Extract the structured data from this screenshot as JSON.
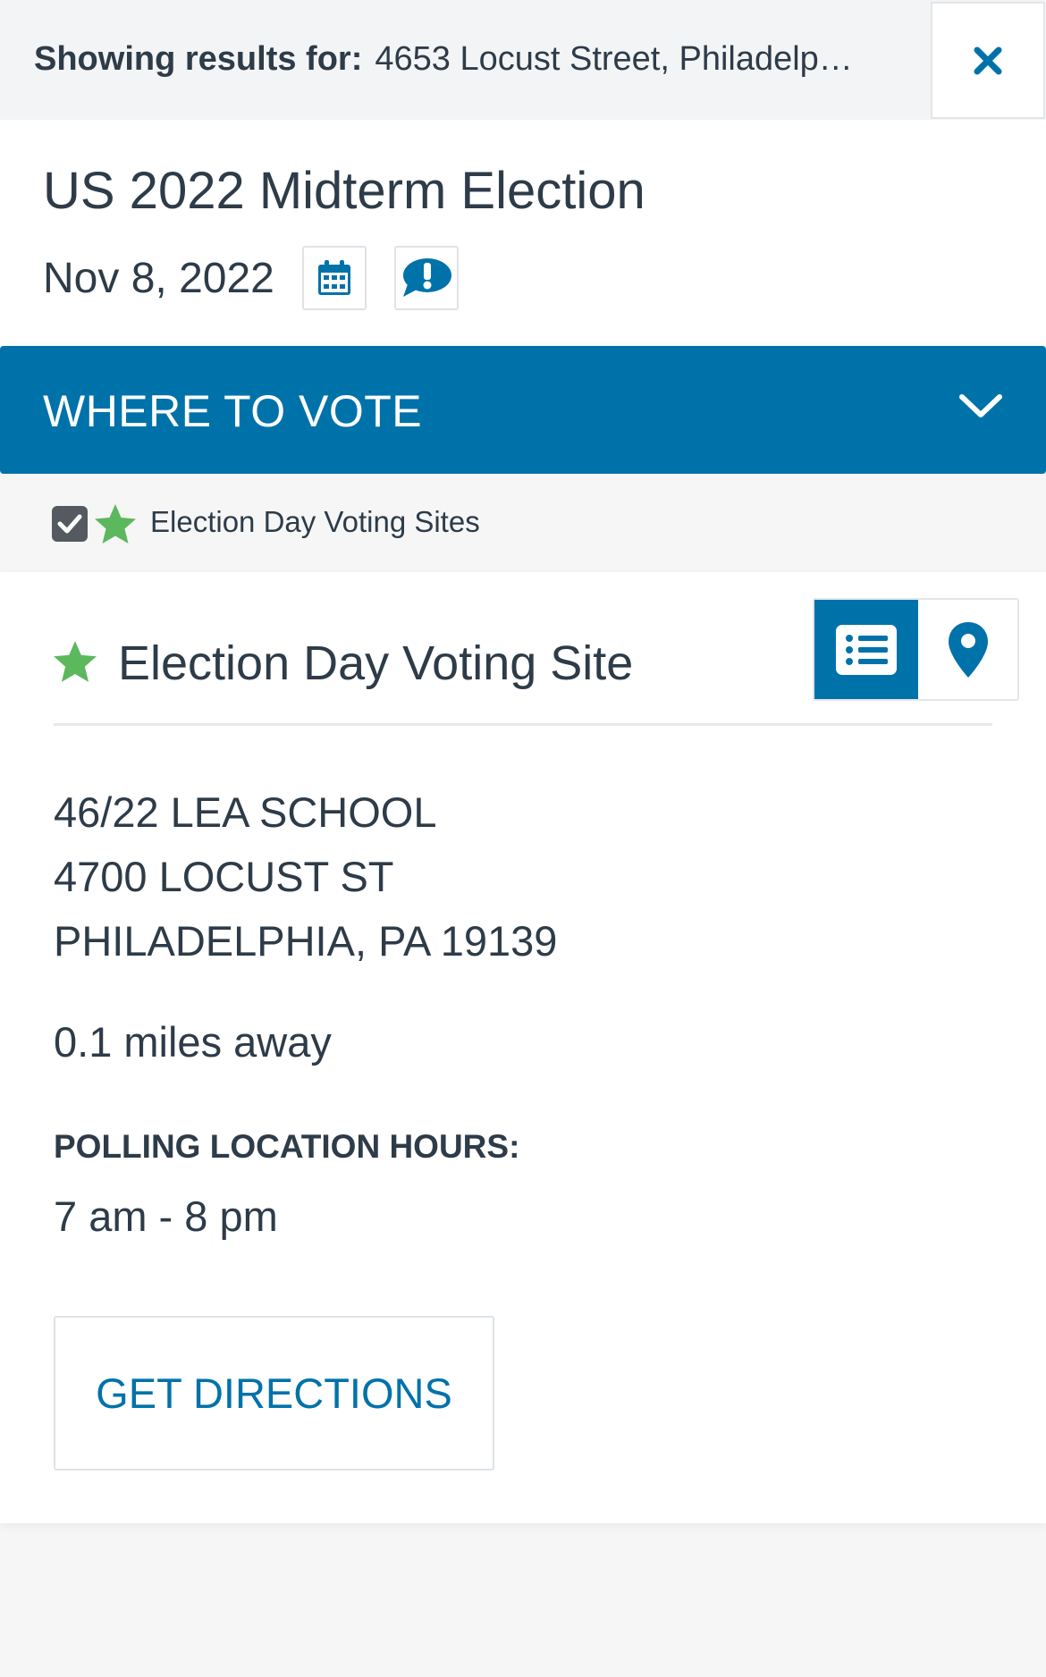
{
  "search": {
    "label": "Showing results for:",
    "address": "4653 Locust Street, Philadelp…"
  },
  "election": {
    "title": "US 2022 Midterm Election",
    "date": "Nov 8, 2022"
  },
  "section": {
    "title": "WHERE TO VOTE"
  },
  "filter": {
    "label": "Election Day Voting Sites",
    "checked": true
  },
  "site": {
    "type": "Election Day Voting Site",
    "address_lines": [
      "46/22 LEA SCHOOL",
      "4700 LOCUST ST",
      "PHILADELPHIA, PA 19139"
    ],
    "distance": "0.1 miles away",
    "hours_label": "POLLING LOCATION HOURS:",
    "hours": "7 am - 8 pm",
    "directions_label": "GET DIRECTIONS"
  },
  "colors": {
    "primary": "#0072aa",
    "star": "#5cb85c",
    "text": "#2e3b48"
  },
  "icons": {
    "close": "close-icon",
    "calendar": "calendar-icon",
    "alert": "alert-bubble-icon",
    "chevron": "chevron-down-icon",
    "star": "star-icon",
    "list": "list-view-icon",
    "map": "map-pin-icon"
  }
}
